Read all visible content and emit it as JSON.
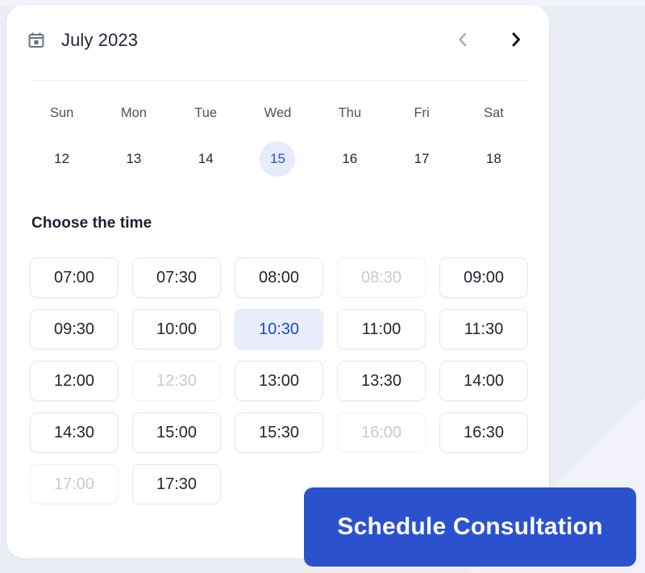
{
  "theme": {
    "accent": "#2b51cf",
    "selected_bg": "#e9eefc",
    "selected_text": "#2146d6",
    "card_bg": "#ffffff",
    "page_bg": "#eaedf3",
    "disabled_text": "#c9cbd2"
  },
  "header": {
    "calendar_icon": "calendar-icon",
    "month_label": "July 2023",
    "prev_label": "‹",
    "next_label": "›",
    "prev_icon": "chevron-left-icon",
    "next_icon": "chevron-right-icon"
  },
  "calendar": {
    "weekdays": [
      "Sun",
      "Mon",
      "Tue",
      "Wed",
      "Thu",
      "Fri",
      "Sat"
    ],
    "dates": [
      {
        "label": "12",
        "selected": false
      },
      {
        "label": "13",
        "selected": false
      },
      {
        "label": "14",
        "selected": false
      },
      {
        "label": "15",
        "selected": true
      },
      {
        "label": "16",
        "selected": false
      },
      {
        "label": "17",
        "selected": false
      },
      {
        "label": "18",
        "selected": false
      }
    ]
  },
  "time_section": {
    "title": "Choose the time",
    "slots": [
      {
        "label": "07:00",
        "state": "available"
      },
      {
        "label": "07:30",
        "state": "available"
      },
      {
        "label": "08:00",
        "state": "available"
      },
      {
        "label": "08:30",
        "state": "disabled"
      },
      {
        "label": "09:00",
        "state": "available"
      },
      {
        "label": "09:30",
        "state": "available"
      },
      {
        "label": "10:00",
        "state": "available"
      },
      {
        "label": "10:30",
        "state": "selected"
      },
      {
        "label": "11:00",
        "state": "available"
      },
      {
        "label": "11:30",
        "state": "available"
      },
      {
        "label": "12:00",
        "state": "available"
      },
      {
        "label": "12:30",
        "state": "disabled"
      },
      {
        "label": "13:00",
        "state": "available"
      },
      {
        "label": "13:30",
        "state": "available"
      },
      {
        "label": "14:00",
        "state": "available"
      },
      {
        "label": "14:30",
        "state": "available"
      },
      {
        "label": "15:00",
        "state": "available"
      },
      {
        "label": "15:30",
        "state": "available"
      },
      {
        "label": "16:00",
        "state": "disabled"
      },
      {
        "label": "16:30",
        "state": "available"
      },
      {
        "label": "17:00",
        "state": "disabled"
      },
      {
        "label": "17:30",
        "state": "available"
      }
    ]
  },
  "cta": {
    "label": "Schedule Consultation"
  }
}
